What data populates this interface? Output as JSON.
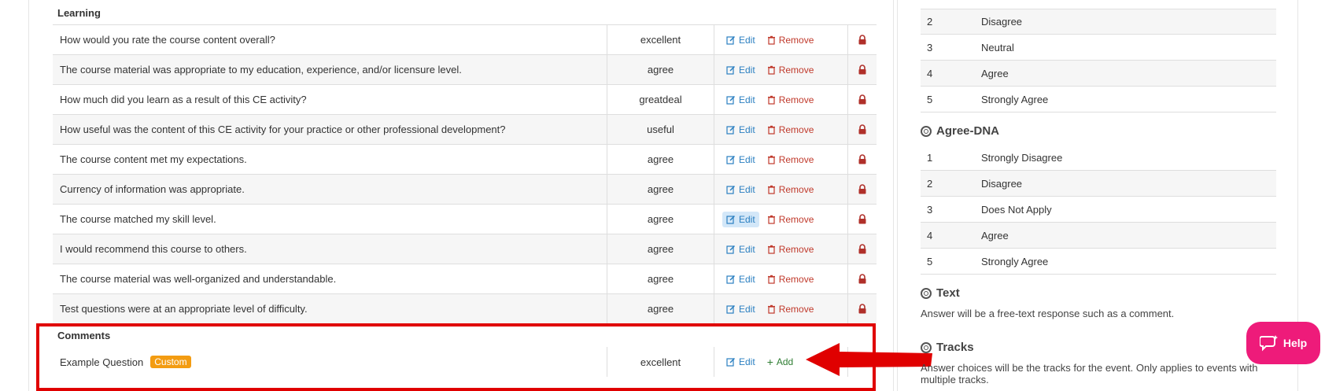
{
  "sections": {
    "learning": "Learning",
    "comments": "Comments"
  },
  "actions": {
    "edit": "Edit",
    "remove": "Remove",
    "add": "Add"
  },
  "learning_rows": [
    {
      "question": "How would you rate the course content overall?",
      "answer": "excellent"
    },
    {
      "question": "The course material was appropriate to my education, experience, and/or licensure level.",
      "answer": "agree"
    },
    {
      "question": "How much did you learn as a result of this CE activity?",
      "answer": "greatdeal"
    },
    {
      "question": "How useful was the content of this CE activity for your practice or other professional development?",
      "answer": "useful"
    },
    {
      "question": "The course content met my expectations.",
      "answer": "agree"
    },
    {
      "question": "Currency of information was appropriate.",
      "answer": "agree"
    },
    {
      "question": "The course matched my skill level.",
      "answer": "agree"
    },
    {
      "question": "I would recommend this course to others.",
      "answer": "agree"
    },
    {
      "question": "The course material was well-organized and understandable.",
      "answer": "agree"
    },
    {
      "question": "Test questions were at an appropriate level of difficulty.",
      "answer": "agree"
    }
  ],
  "comment_row": {
    "question": "Example Question",
    "badge": "Custom",
    "answer": "excellent"
  },
  "agree_top_rows": [
    {
      "num": "2",
      "label": "Disagree"
    },
    {
      "num": "3",
      "label": "Neutral"
    },
    {
      "num": "4",
      "label": "Agree"
    },
    {
      "num": "5",
      "label": "Strongly Agree"
    }
  ],
  "agree_dna": {
    "title": "Agree-DNA",
    "rows": [
      {
        "num": "1",
        "label": "Strongly Disagree"
      },
      {
        "num": "2",
        "label": "Disagree"
      },
      {
        "num": "3",
        "label": "Does Not Apply"
      },
      {
        "num": "4",
        "label": "Agree"
      },
      {
        "num": "5",
        "label": "Strongly Agree"
      }
    ]
  },
  "text_type": {
    "title": "Text",
    "desc": "Answer will be a free-text response such as a comment."
  },
  "tracks_type": {
    "title": "Tracks",
    "desc_line1": "Answer choices will be the tracks for the event. Only applies to events with",
    "desc_line2": "multiple tracks."
  },
  "help": {
    "label": "Help"
  },
  "colors": {
    "annotation_red": "#e00000",
    "help_pink": "#ee1b7a",
    "edit_blue": "#2a7fc1",
    "remove_red": "#c0392b",
    "add_green": "#2e7d32",
    "badge_orange": "#f39c12"
  }
}
